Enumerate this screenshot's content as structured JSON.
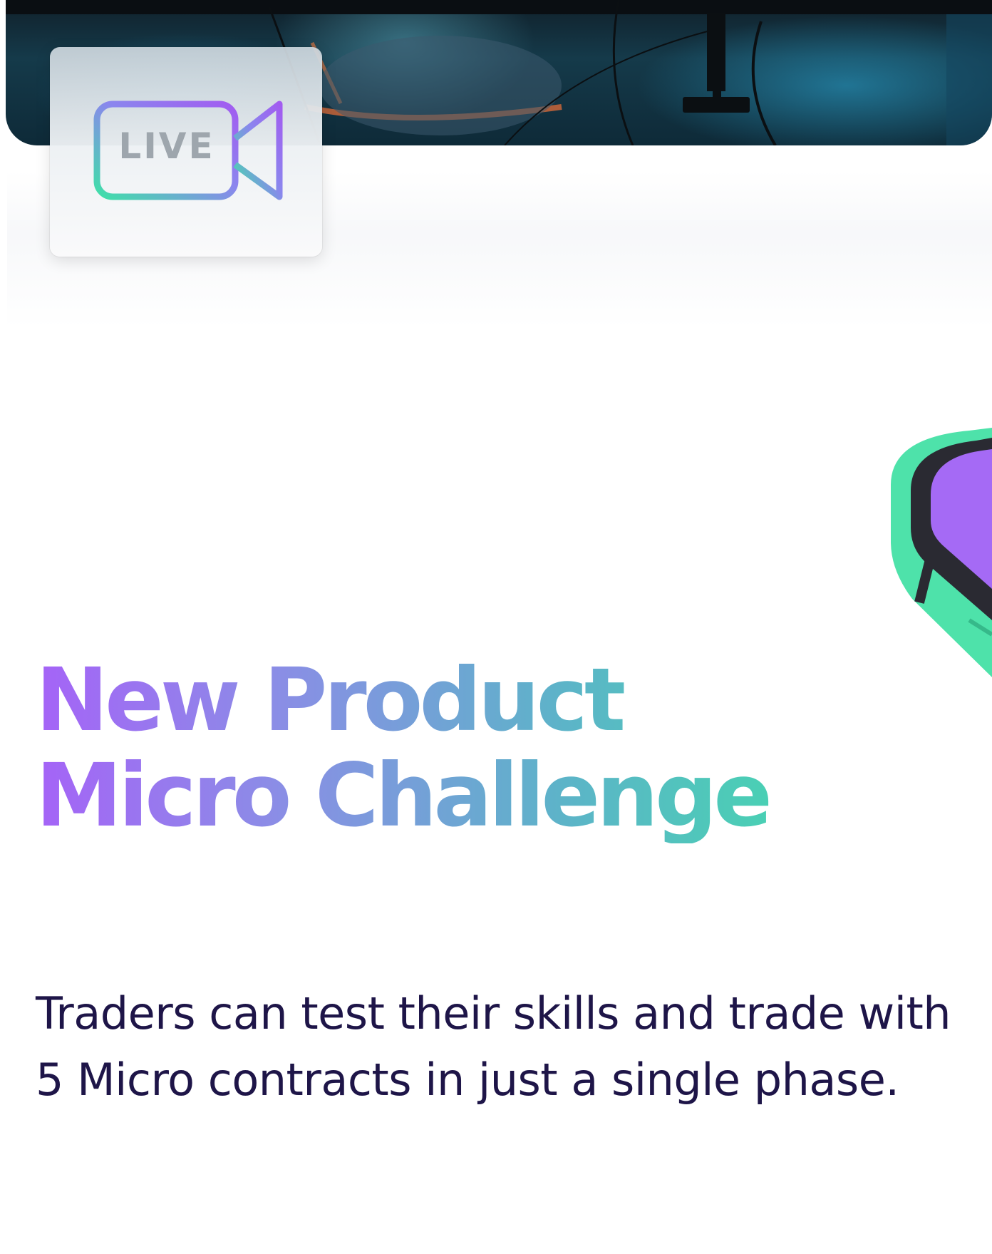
{
  "hero": {
    "live_badge": {
      "text": "LIVE",
      "icon": "video-camera-icon",
      "gradient_colors": [
        "#a25cf0",
        "#3fe0a8"
      ]
    }
  },
  "phone": {
    "icon": "smartphone-icon",
    "body_color": "#4ee2aa",
    "screen_color": "#a56af5"
  },
  "headline": {
    "line1": "New Product",
    "line2": "Micro Challenge",
    "gradient_colors": [
      "#a563f7",
      "#3fe0a8"
    ]
  },
  "body": {
    "text": "Traders can test their skills and trade with 5 Micro contracts in just a single phase.",
    "color": "#1e1548"
  }
}
